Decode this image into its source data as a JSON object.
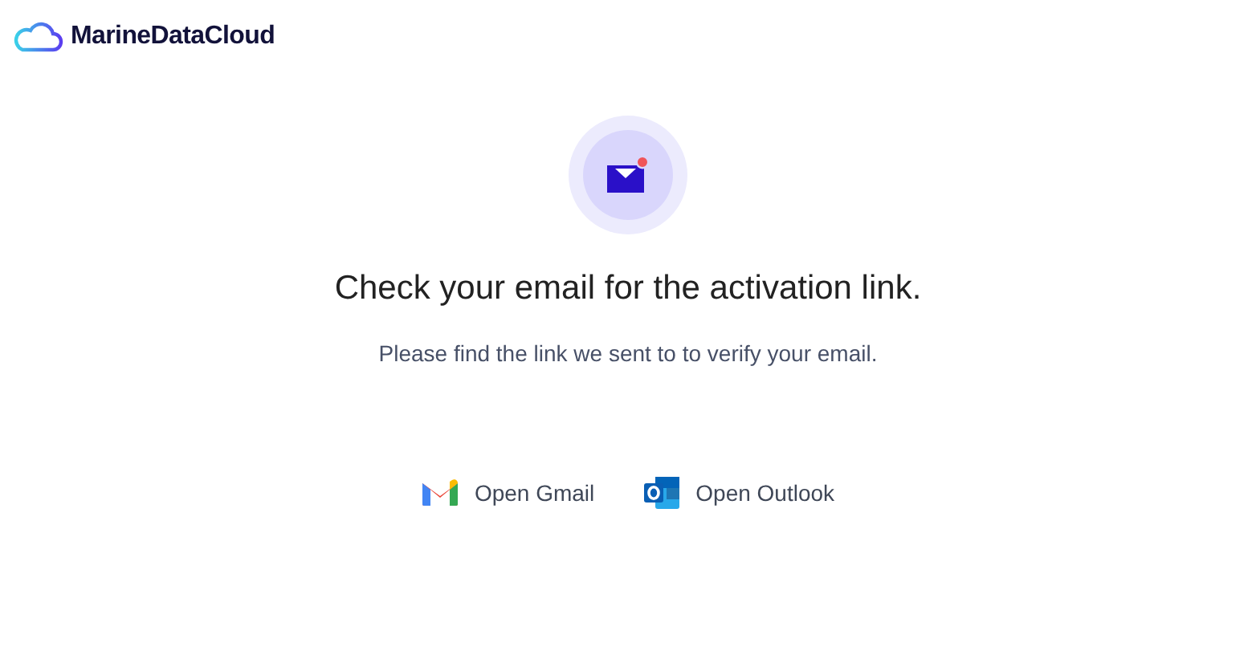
{
  "brand": {
    "name": "MarineDataCloud"
  },
  "notice": {
    "unread": true,
    "title": "Check your email for the activation link.",
    "message": "Please find the link we sent to to verify your email."
  },
  "links": [
    {
      "kind": "gmail",
      "label": "Open Gmail"
    },
    {
      "kind": "outlook",
      "label": "Open Outlook"
    }
  ]
}
